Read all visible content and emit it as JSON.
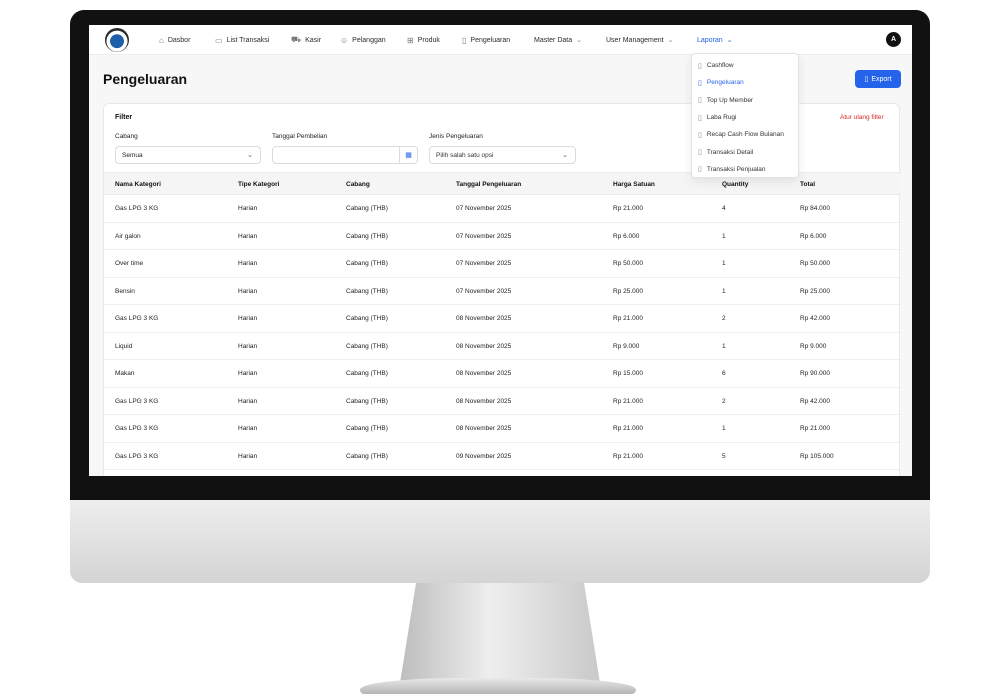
{
  "nav": {
    "items": [
      {
        "label": "Dasbor",
        "icon": "home-icon",
        "glyph": "⌂"
      },
      {
        "label": "List Transaksi",
        "icon": "receipt-icon",
        "glyph": "▭"
      },
      {
        "label": "Kasir",
        "icon": "cart-icon",
        "glyph": "⛟"
      },
      {
        "label": "Pelanggan",
        "icon": "users-icon",
        "glyph": "☺"
      },
      {
        "label": "Produk",
        "icon": "grid-icon",
        "glyph": "⊞"
      },
      {
        "label": "Pengeluaran",
        "icon": "document-icon",
        "glyph": "▯"
      },
      {
        "label": "Master Data",
        "icon": "chevron-down-icon",
        "glyph": "⌄"
      },
      {
        "label": "User Management",
        "icon": "chevron-down-icon",
        "glyph": "⌄"
      },
      {
        "label": "Laporan",
        "icon": "chevron-down-icon",
        "glyph": "⌄"
      }
    ],
    "avatar": "A"
  },
  "page": {
    "title": "Pengeluaran",
    "export_label": "Export"
  },
  "filter": {
    "title": "Filter",
    "reset_label": "Atur ulang filter",
    "cabang_label": "Cabang",
    "cabang_value": "Semua",
    "tanggal_label": "Tanggal Pembelian",
    "tanggal_value": "",
    "jenis_label": "Jenis Pengeluaran",
    "jenis_placeholder": "Pilih salah satu opsi"
  },
  "table": {
    "headers": [
      "Nama Kategori",
      "Tipe Kategori",
      "Cabang",
      "Tanggal Pengeluaran",
      "Harga Satuan",
      "Quantity",
      "Total"
    ],
    "rows": [
      [
        "Gas LPG 3 KG",
        "Harian",
        "Cabang (THB)",
        "07 November 2025",
        "Rp 21.000",
        "4",
        "Rp 84.000"
      ],
      [
        "Air galon",
        "Harian",
        "Cabang (THB)",
        "07 November 2025",
        "Rp 6.000",
        "1",
        "Rp 6.000"
      ],
      [
        "Over time",
        "Harian",
        "Cabang (THB)",
        "07 November 2025",
        "Rp 50.000",
        "1",
        "Rp 50.000"
      ],
      [
        "Bensin",
        "Harian",
        "Cabang (THB)",
        "07 November 2025",
        "Rp 25.000",
        "1",
        "Rp 25.000"
      ],
      [
        "Gas LPG 3 KG",
        "Harian",
        "Cabang (THB)",
        "08 November 2025",
        "Rp 21.000",
        "2",
        "Rp 42.000"
      ],
      [
        "Liquid",
        "Harian",
        "Cabang (THB)",
        "08 November 2025",
        "Rp 9.000",
        "1",
        "Rp 9.000"
      ],
      [
        "Makan",
        "Harian",
        "Cabang (THB)",
        "08 November 2025",
        "Rp 15.000",
        "6",
        "Rp 90.000"
      ],
      [
        "Gas LPG 3 KG",
        "Harian",
        "Cabang (THB)",
        "08 November 2025",
        "Rp 21.000",
        "2",
        "Rp 42.000"
      ],
      [
        "Gas LPG 3 KG",
        "Harian",
        "Cabang (THB)",
        "08 November 2025",
        "Rp 21.000",
        "1",
        "Rp 21.000"
      ],
      [
        "Gas LPG 3 KG",
        "Harian",
        "Cabang (THB)",
        "09 November 2025",
        "Rp 21.000",
        "5",
        "Rp 105.000"
      ]
    ]
  },
  "laporan_menu": {
    "items": [
      "Cashflow",
      "Pengeluaran",
      "Top Up Member",
      "Laba Rugi",
      "Recap Cash Flow Bulanan",
      "Transaksi Detail",
      "Transaksi Penjualan"
    ],
    "active_index": 1
  },
  "colors": {
    "accent": "#2563eb",
    "danger": "#dc2626"
  }
}
